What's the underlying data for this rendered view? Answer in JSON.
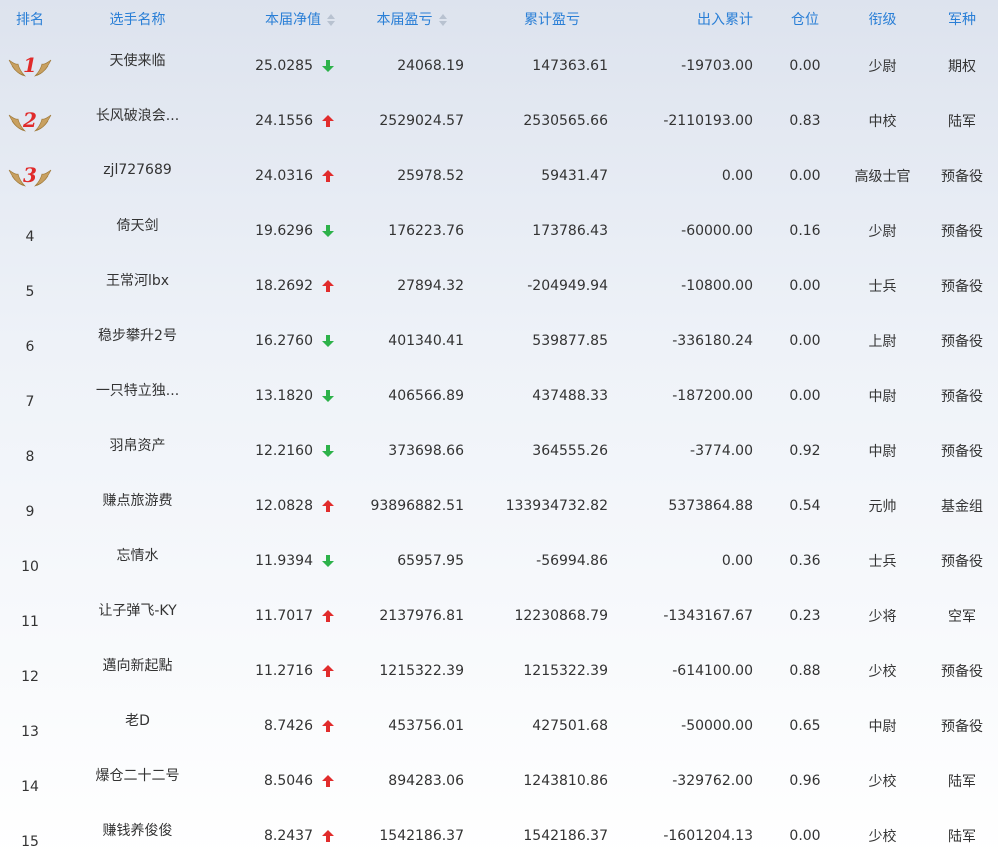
{
  "colors": {
    "header_text": "#2a7fd6",
    "up": "#e12c2c",
    "down": "#2db24a",
    "medal_number": "#e02a2a",
    "wing": "#c8a060"
  },
  "columns": [
    {
      "key": "rank",
      "label": "排名",
      "sortable": false
    },
    {
      "key": "name",
      "label": "选手名称",
      "sortable": false
    },
    {
      "key": "nav",
      "label": "本届净值",
      "sortable": true
    },
    {
      "key": "pnl",
      "label": "本届盈亏",
      "sortable": true
    },
    {
      "key": "total_pnl",
      "label": "累计盈亏",
      "sortable": false
    },
    {
      "key": "flow",
      "label": "出入累计",
      "sortable": false
    },
    {
      "key": "position",
      "label": "仓位",
      "sortable": false
    },
    {
      "key": "title",
      "label": "衔级",
      "sortable": false
    },
    {
      "key": "branch",
      "label": "军种",
      "sortable": false
    }
  ],
  "rows": [
    {
      "rank": "1",
      "medal": true,
      "name": "天使来临",
      "nav": "25.0285",
      "trend": "down-arrow-icon",
      "pnl": "24068.19",
      "total_pnl": "147363.61",
      "flow": "-19703.00",
      "position": "0.00",
      "title": "少尉",
      "branch": "期权"
    },
    {
      "rank": "2",
      "medal": true,
      "name": "长风破浪会...",
      "nav": "24.1556",
      "trend": "up-arrow-icon",
      "pnl": "2529024.57",
      "total_pnl": "2530565.66",
      "flow": "-2110193.00",
      "position": "0.83",
      "title": "中校",
      "branch": "陆军"
    },
    {
      "rank": "3",
      "medal": true,
      "name": "zjl727689",
      "nav": "24.0316",
      "trend": "up-arrow-icon",
      "pnl": "25978.52",
      "total_pnl": "59431.47",
      "flow": "0.00",
      "position": "0.00",
      "title": "高级士官",
      "branch": "预备役"
    },
    {
      "rank": "4",
      "medal": false,
      "name": "倚天剑",
      "nav": "19.6296",
      "trend": "down-arrow-icon",
      "pnl": "176223.76",
      "total_pnl": "173786.43",
      "flow": "-60000.00",
      "position": "0.16",
      "title": "少尉",
      "branch": "预备役"
    },
    {
      "rank": "5",
      "medal": false,
      "name": "王常河lbx",
      "nav": "18.2692",
      "trend": "up-arrow-icon",
      "pnl": "27894.32",
      "total_pnl": "-204949.94",
      "flow": "-10800.00",
      "position": "0.00",
      "title": "士兵",
      "branch": "预备役"
    },
    {
      "rank": "6",
      "medal": false,
      "name": "稳步攀升2号",
      "nav": "16.2760",
      "trend": "down-arrow-icon",
      "pnl": "401340.41",
      "total_pnl": "539877.85",
      "flow": "-336180.24",
      "position": "0.00",
      "title": "上尉",
      "branch": "预备役"
    },
    {
      "rank": "7",
      "medal": false,
      "name": "一只特立独...",
      "nav": "13.1820",
      "trend": "down-arrow-icon",
      "pnl": "406566.89",
      "total_pnl": "437488.33",
      "flow": "-187200.00",
      "position": "0.00",
      "title": "中尉",
      "branch": "预备役"
    },
    {
      "rank": "8",
      "medal": false,
      "name": "羽帛资产",
      "nav": "12.2160",
      "trend": "down-arrow-icon",
      "pnl": "373698.66",
      "total_pnl": "364555.26",
      "flow": "-3774.00",
      "position": "0.92",
      "title": "中尉",
      "branch": "预备役"
    },
    {
      "rank": "9",
      "medal": false,
      "name": "赚点旅游费",
      "nav": "12.0828",
      "trend": "up-arrow-icon",
      "pnl": "93896882.51",
      "total_pnl": "133934732.82",
      "flow": "5373864.88",
      "position": "0.54",
      "title": "元帅",
      "branch": "基金组"
    },
    {
      "rank": "10",
      "medal": false,
      "name": "忘情水",
      "nav": "11.9394",
      "trend": "down-arrow-icon",
      "pnl": "65957.95",
      "total_pnl": "-56994.86",
      "flow": "0.00",
      "position": "0.36",
      "title": "士兵",
      "branch": "预备役"
    },
    {
      "rank": "11",
      "medal": false,
      "name": "让子弹飞-KY",
      "nav": "11.7017",
      "trend": "up-arrow-icon",
      "pnl": "2137976.81",
      "total_pnl": "12230868.79",
      "flow": "-1343167.67",
      "position": "0.23",
      "title": "少将",
      "branch": "空军"
    },
    {
      "rank": "12",
      "medal": false,
      "name": "邁向新起點",
      "nav": "11.2716",
      "trend": "up-arrow-icon",
      "pnl": "1215322.39",
      "total_pnl": "1215322.39",
      "flow": "-614100.00",
      "position": "0.88",
      "title": "少校",
      "branch": "预备役"
    },
    {
      "rank": "13",
      "medal": false,
      "name": "老D",
      "nav": "8.7426",
      "trend": "up-arrow-icon",
      "pnl": "453756.01",
      "total_pnl": "427501.68",
      "flow": "-50000.00",
      "position": "0.65",
      "title": "中尉",
      "branch": "预备役"
    },
    {
      "rank": "14",
      "medal": false,
      "name": "爆仓二十二号",
      "nav": "8.5046",
      "trend": "up-arrow-icon",
      "pnl": "894283.06",
      "total_pnl": "1243810.86",
      "flow": "-329762.00",
      "position": "0.96",
      "title": "少校",
      "branch": "陆军"
    },
    {
      "rank": "15",
      "medal": false,
      "name": "赚钱养俊俊",
      "nav": "8.2437",
      "trend": "up-arrow-icon",
      "pnl": "1542186.37",
      "total_pnl": "1542186.37",
      "flow": "-1601204.13",
      "position": "0.00",
      "title": "少校",
      "branch": "陆军"
    }
  ]
}
